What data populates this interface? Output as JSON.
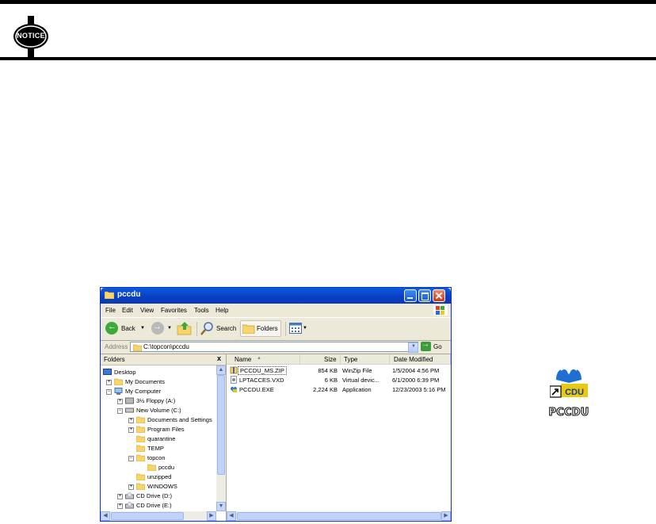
{
  "notice": {
    "label": "NOTICE"
  },
  "window": {
    "title": "pccdu",
    "menu": [
      "File",
      "Edit",
      "View",
      "Favorites",
      "Tools",
      "Help"
    ],
    "toolbar": {
      "back_label": "Back",
      "search_label": "Search",
      "folders_label": "Folders"
    },
    "address": {
      "label": "Address",
      "value": "C:\\topcon\\pccdu",
      "go_label": "Go"
    },
    "folders_pane": {
      "title": "Folders",
      "close_glyph": "x",
      "tree": [
        {
          "label": "Desktop"
        },
        {
          "label": "My Documents",
          "expander": "+"
        },
        {
          "label": "My Computer",
          "expander": "−"
        },
        {
          "label": "3½ Floppy (A:)",
          "expander": "+"
        },
        {
          "label": "New Volume (C:)",
          "expander": "−"
        },
        {
          "label": "Documents and Settings",
          "expander": "+"
        },
        {
          "label": "Program Files",
          "expander": "+"
        },
        {
          "label": "quarantine"
        },
        {
          "label": "TEMP"
        },
        {
          "label": "topcon",
          "expander": "−"
        },
        {
          "label": "pccdu"
        },
        {
          "label": "unzipped"
        },
        {
          "label": "WINDOWS",
          "expander": "+"
        },
        {
          "label": "CD Drive (D:)",
          "expander": "+"
        },
        {
          "label": "CD Drive (E:)",
          "expander": "+"
        }
      ]
    },
    "file_list": {
      "columns": [
        "Name",
        "Size",
        "Type",
        "Date Modified"
      ],
      "rows": [
        {
          "name": "PCCDU_MS.ZIP",
          "size": "854 KB",
          "type": "WinZip File",
          "date": "1/5/2004 4:56 PM"
        },
        {
          "name": "LPTACCES.VXD",
          "size": "6 KB",
          "type": "Virtual devic...",
          "date": "6/1/2000 6:39 PM"
        },
        {
          "name": "PCCDU.EXE",
          "size": "2,224 KB",
          "type": "Application",
          "date": "12/23/2003 5:16 PM"
        }
      ]
    }
  },
  "shortcut": {
    "label": "PCCDU",
    "icon_text": "CDU"
  }
}
